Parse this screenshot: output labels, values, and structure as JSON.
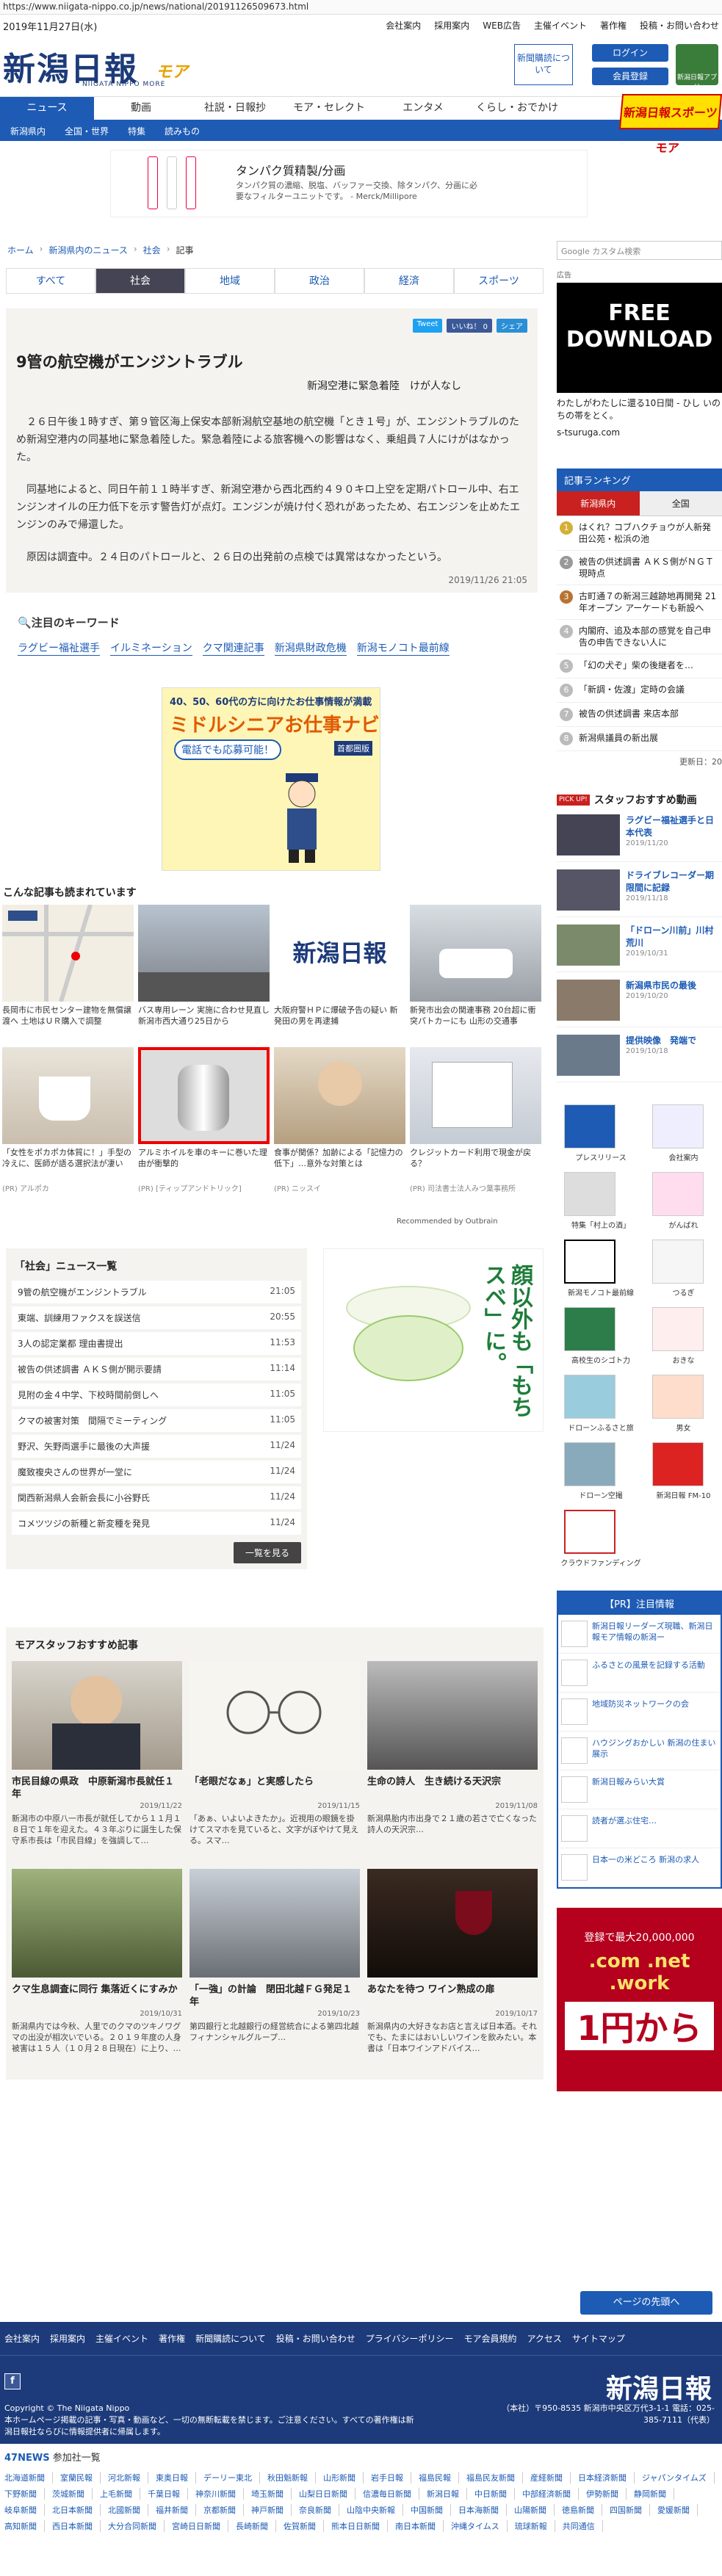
{
  "url": "https://www.niigata-nippo.co.jp/news/national/20191126509673.html",
  "date": "2019年11月27日(水)",
  "top_links": [
    "会社案内",
    "採用案内",
    "WEB広告",
    "主催イベント",
    "著作権",
    "投稿・お問い合わせ"
  ],
  "header": {
    "logo": "新潟日報",
    "logo_more": "モア",
    "logo_sub": "NIIGATA NIPPO MORE",
    "subscribe": "新聞購読について",
    "login": "ログイン",
    "register": "会員登録",
    "app": "新潟日報アプリ"
  },
  "nav": {
    "items": [
      "ニュース",
      "動画",
      "社説・日報抄",
      "モア・セレクト",
      "エンタメ",
      "くらし・おでかけ"
    ],
    "sports": "新潟日報スポーツモア"
  },
  "subnav": [
    "新潟県内",
    "全国・世界",
    "特集",
    "読みもの"
  ],
  "ad_banner": {
    "title": "タンパク質精製/分画",
    "text": "タンパク質の濃縮、脱塩、バッファー交換、除タンパク、分画に必要なフィルターユニットです。 - Merck/Millipore"
  },
  "breadcrumb": [
    "ホーム",
    "新潟県内のニュース",
    "社会",
    "記事"
  ],
  "category_tabs": [
    "すべて",
    "社会",
    "地域",
    "政治",
    "経済",
    "スポーツ"
  ],
  "share": {
    "tweet": "Tweet",
    "fb": "いいね！ 0",
    "share": "シェア"
  },
  "article": {
    "title": "9管の航空機がエンジントラブル",
    "subtitle": "新潟空港に緊急着陸　けが人なし",
    "paragraphs": [
      "２６日午後１時すぎ、第９管区海上保安本部新潟航空基地の航空機「とき１号」が、エンジントラブルのため新潟空港内の同基地に緊急着陸した。緊急着陸による旅客機への影響はなく、乗組員７人にけがはなかった。",
      "同基地によると、同日午前１１時半すぎ、新潟空港から西北西約４９０キロ上空を定期パトロール中、右エンジンオイルの圧力低下を示す警告灯が点灯。エンジンが焼け付く恐れがあったため、右エンジンを止めたエンジンのみで帰還した。",
      "原因は調査中。２４日のパトロールと、２６日の出発前の点検では異常はなかったという。"
    ],
    "datetime": "2019/11/26 21:05"
  },
  "keywords": {
    "title": "注目のキーワード",
    "items": [
      "ラグビー福祉選手",
      "イルミネーション",
      "クマ関連記事",
      "新潟県財政危機",
      "新潟モノコト最前線"
    ]
  },
  "senior_ad": {
    "line1": "40、50、60代の方に向けたお仕事情報が満載",
    "line2": "ミドルシニアお仕事ナビ",
    "line3": "電話でも応募可能！",
    "brand": "首都圏版"
  },
  "recommended_title": "こんな記事も読まれています",
  "recommended": [
    {
      "caption": "長岡市に市民センター建物を無償譲渡へ 土地はＵＲ購入で調整",
      "pr": ""
    },
    {
      "caption": "バス専用レーン 実施に合わせ見直し 新潟市西大通り25日から",
      "pr": ""
    },
    {
      "caption": "大阪府警ＨＰに爆破予告の疑い 新発田の男を再逮捕",
      "pr": ""
    },
    {
      "caption": "新発市出会の関連事務 20台超に衝突パトカーにも 山形の交通事",
      "pr": ""
    },
    {
      "caption": "「女性をポカポカ体質に！」手型の冷えに、医師が語る選択法が凄い",
      "pr": "(PR) アルポカ"
    },
    {
      "caption": "アルミホイルを車のキーに巻いた理由が衝撃的",
      "pr": "(PR) [ティップアンドトリック]"
    },
    {
      "caption": "食事が関係？加齢による「記憶力の低下」…意外な対策とは",
      "pr": "(PR) ニッスイ"
    },
    {
      "caption": "クレジットカード利用で現金が戻る？",
      "pr": "(PR) 司法書士法人みつ葉事務所"
    }
  ],
  "recommended_by": "Recommended by Outbrain",
  "news_list": {
    "title": "「社会」ニュース一覧",
    "items": [
      {
        "title": "9管の航空機がエンジントラブル",
        "time": "21:05"
      },
      {
        "title": "東端、訓練用ファクスを誤送信",
        "time": "20:55"
      },
      {
        "title": "3人の認定業都 理由書提出",
        "time": "11:53"
      },
      {
        "title": "被告の供述調書 ＡＫＳ側が開示要請",
        "time": "11:14"
      },
      {
        "title": "見附の金４中学、下校時間前倒しへ",
        "time": "11:05"
      },
      {
        "title": "クマの被害対策　間隔でミーティング",
        "time": "11:05"
      },
      {
        "title": "野沢、矢野両選手に最後の大声援",
        "time": "11/24"
      },
      {
        "title": "魔致複央さんの世界が一堂に",
        "time": "11/24"
      },
      {
        "title": "関西新潟県人会新会長に小谷野氏",
        "time": "11/24"
      },
      {
        "title": "コメツツジの新種と新変種を発見",
        "time": "11/24"
      }
    ],
    "more": "一覧を見る"
  },
  "menta_ad": {
    "text": "顔以外も「もちスベ」に。"
  },
  "staff": {
    "title": "モアスタッフおすすめ記事",
    "items": [
      {
        "title": "市民目線の県政　中原新潟市長就任１年",
        "date": "2019/11/22",
        "excerpt": "新潟市の中原八一市長が就任してから１１月１８日で１年を迎えた。４３年ぶりに誕生した保守系市長は「市民目線」を強調して…"
      },
      {
        "title": "「老眼だなぁ」と実感したら",
        "date": "2019/11/15",
        "excerpt": "「あぁ、いよいよきたか」。近視用の眼鏡を掛けてスマホを見ていると、文字がぼやけて見える。スマ…"
      },
      {
        "title": "生命の詩人　生き続ける天沢宗",
        "date": "2019/11/08",
        "excerpt": "新潟県胎内市出身で２１歳の若さで亡くなった詩人の天沢宗…"
      },
      {
        "title": "クマ生息調査に同行 集落近くにすみか",
        "date": "2019/10/31",
        "excerpt": "新潟県内では今秋、人里でのクマのツキノワグマの出没が相次いでいる。２０１９年度の人身被害は１５人（１０月２８日現在）に上り、…"
      },
      {
        "title": "「一強」の計論　閉田北越ＦＧ発足１年",
        "date": "2019/10/23",
        "excerpt": "第四銀行と北越銀行の経営統合による第四北越フィナンシャルグループ…"
      },
      {
        "title": "あなたを待つ ワイン熟成の扉",
        "date": "2019/10/17",
        "excerpt": "新潟県内の大好きなお店と言えば日本酒。それでも、たまにはおいしいワインを飲みたい。本書は「日本ワインアドバイス…"
      }
    ]
  },
  "sidebar": {
    "search_placeholder": "Google カスタム検索",
    "ad_label": "広告",
    "download_ad": "FREE DOWNLOAD",
    "download_caption": "わたしがわたしに還る10日間 - ひし いのちの帯をとく。",
    "download_site": "s-tsuruga.com",
    "ranking_title": "記事ランキング",
    "ranking_tabs": [
      "新潟県内",
      "全国"
    ],
    "ranking": [
      "はくれ？コブハクチョウが人新発田公苑・松浜の池",
      "被告の供述調書 ＡＫＳ側がＮＧＴ現時点",
      "古町通７の新潟三越跡地再開発 21年オープン アーケードも新設へ",
      "内閣府、追及本部の感覚を自己申告の申告できない人に",
      "「幻の犬ぞ」柴の後継者を…",
      "「新調・佐渡」定時の会議",
      "被告の供述調書 来店本部",
      "新潟県議員の新出展"
    ],
    "ranking_updated": "更新日：20",
    "pickup_badge": "PICK UP!",
    "pickup_title": "スタッフおすすめ動画",
    "videos": [
      {
        "title": "ラグビー福祉選手と日本代表",
        "date": "2019/11/20"
      },
      {
        "title": "ドライブレコーダー期限間に記録",
        "date": "2019/11/18"
      },
      {
        "title": "「ドローン川前」川村荒川",
        "date": "2019/10/31"
      },
      {
        "title": "新潟県市民の最後",
        "date": "2019/10/20"
      },
      {
        "title": "提供映像　発端で",
        "date": "2019/10/18"
      }
    ],
    "banners": [
      "プレスリリース",
      "会社案内",
      "特集「村上の酒」",
      "がんばれ",
      "新潟モノコト最前線",
      "つるぎ",
      "高校生のシゴト力",
      "おきな",
      "ドローンふるさと旅",
      "男女",
      "ドローン空撮",
      "新潟日報 FM-10",
      "クラウドファンディング"
    ],
    "pr_title": "【PR】注目情報",
    "pr_items": [
      "新潟日報リーダーズ現職、新潟日報モア情報の新潟ー",
      "ふるさとの風景を記録する活動",
      "地域防災ネットワークの会",
      "ハウジングおかしい 新潟の住まい展示",
      "新潟日報みらい大賞",
      "読者が選ぶ住宅…",
      "日本一の米どころ 新潟の求人"
    ],
    "money_ad": {
      "line1": "登録で最大20,000,000",
      "line2": ".com .net .work",
      "line3": "1円から",
      "line4": ""
    }
  },
  "page_top": "ページの先頭へ",
  "footer": {
    "links": [
      "会社案内",
      "採用案内",
      "主催イベント",
      "著作権",
      "新聞購読について",
      "投稿・お問い合わせ",
      "プライバシーポリシー",
      "モア会員規約",
      "アクセス",
      "サイトマップ"
    ],
    "copyright": "Copyright © The Niigata Nippo",
    "notice": "本ホームページ掲載の記事・写真・動画など、一切の無断転載を禁じます。ご注意ください。すべての著作権は新潟日報社ならびに情報提供者に帰属します。",
    "logo": "新潟日報",
    "address": "（本社）〒950-8535 新潟市中央区万代3-1-1 電話：025-385-7111（代表）",
    "n47": "47NEWS",
    "n47_label": "参加社一覧",
    "papers": [
      "北海道新聞",
      "室蘭民報",
      "河北新報",
      "東奥日報",
      "デーリー東北",
      "秋田魁新報",
      "山形新聞",
      "岩手日報",
      "福島民報",
      "福島民友新聞",
      "産経新聞",
      "日本経済新聞",
      "ジャパンタイムズ",
      "下野新聞",
      "茨城新聞",
      "上毛新聞",
      "千葉日報",
      "神奈川新聞",
      "埼玉新聞",
      "山梨日日新聞",
      "信濃毎日新聞",
      "新潟日報",
      "中日新聞",
      "中部経済新聞",
      "伊勢新聞",
      "静岡新聞",
      "岐阜新聞",
      "北日本新聞",
      "北國新聞",
      "福井新聞",
      "京都新聞",
      "神戸新聞",
      "奈良新聞",
      "山陰中央新報",
      "中国新聞",
      "日本海新聞",
      "山陽新聞",
      "徳島新聞",
      "四国新聞",
      "愛媛新聞",
      "高知新聞",
      "西日本新聞",
      "大分合同新聞",
      "宮崎日日新聞",
      "長崎新聞",
      "佐賀新聞",
      "熊本日日新聞",
      "南日本新聞",
      "沖縄タイムス",
      "琉球新報",
      "共同通信"
    ]
  }
}
